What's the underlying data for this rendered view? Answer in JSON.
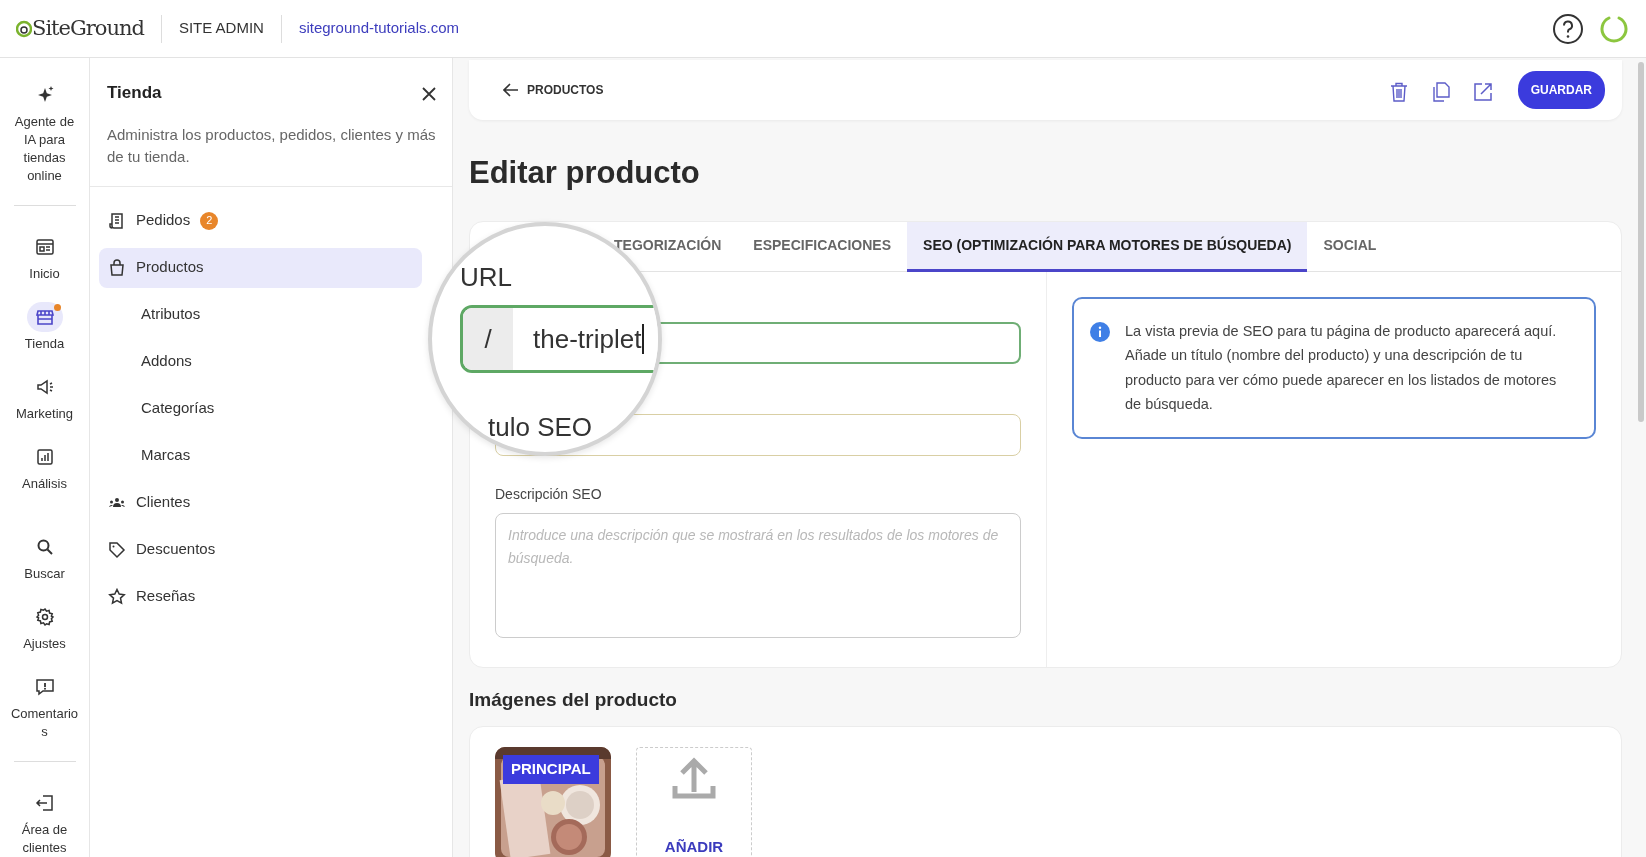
{
  "header": {
    "logo": "SiteGround",
    "section": "SITE ADMIN",
    "site": "siteground-tutorials.com"
  },
  "rail_groups": [
    {
      "items": [
        {
          "label": "Agente de IA para tiendas online",
          "selected": false,
          "notification": false
        }
      ]
    },
    {
      "items": [
        {
          "label": "Inicio",
          "selected": false,
          "notification": false
        },
        {
          "label": "Tienda",
          "selected": true,
          "notification": true
        },
        {
          "label": "Marketing",
          "selected": false,
          "notification": false
        },
        {
          "label": "Análisis",
          "selected": false,
          "notification": false
        }
      ]
    },
    {
      "items": [
        {
          "label": "Buscar",
          "selected": false,
          "notification": false
        },
        {
          "label": "Ajustes",
          "selected": false,
          "notification": false
        },
        {
          "label": "Comentarios",
          "selected": false,
          "notification": false
        }
      ]
    },
    {
      "items": [
        {
          "label": "Área de clientes",
          "selected": false,
          "notification": false
        }
      ]
    }
  ],
  "sidebar": {
    "title": "Tienda",
    "description": "Administra los productos, pedidos, clientes y más de tu tienda.",
    "items": [
      {
        "label": "Pedidos",
        "count": "2",
        "selected": false
      },
      {
        "label": "Productos",
        "selected": true,
        "children": [
          {
            "label": "Atributos",
            "selected": false
          },
          {
            "label": "Addons",
            "selected": false
          },
          {
            "label": "Categorías",
            "selected": false
          },
          {
            "label": "Marcas",
            "selected": false
          }
        ]
      },
      {
        "label": "Clientes",
        "selected": false
      },
      {
        "label": "Descuentos",
        "selected": false
      },
      {
        "label": "Reseñas",
        "selected": false
      }
    ]
  },
  "toolbar": {
    "back": "PRODUCTOS",
    "save": "GUARDAR"
  },
  "page_title": "Editar producto",
  "tabs": [
    {
      "label": "TEGORIZACIÓN",
      "selected": false
    },
    {
      "label": "ESPECIFICACIONES",
      "selected": false
    },
    {
      "label": "SEO (OPTIMIZACIÓN PARA MOTORES DE BÚSQUEDA)",
      "selected": true
    },
    {
      "label": "SOCIAL",
      "selected": false
    }
  ],
  "seo": {
    "url_field": {
      "valid": true
    },
    "description": {
      "label": "Descripción SEO",
      "placeholder": "Introduce una descripción que se mostrará en los resultados de los motores de búsqueda."
    },
    "info": "La vista previa de SEO para tu página de producto aparecerá aquí. Añade un título (nombre del producto) y una descripción de tu producto para ver cómo puede aparecer en los listados de motores de búsqueda."
  },
  "magnifier": {
    "label": "URL",
    "prefix": "/",
    "value": "the-triplet",
    "valid": true,
    "next_label": "tulo SEO"
  },
  "images": {
    "title": "Imágenes del producto",
    "items": [
      {
        "kind": "picture",
        "badge": "PRINCIPAL"
      }
    ],
    "add": "AÑADIR"
  }
}
